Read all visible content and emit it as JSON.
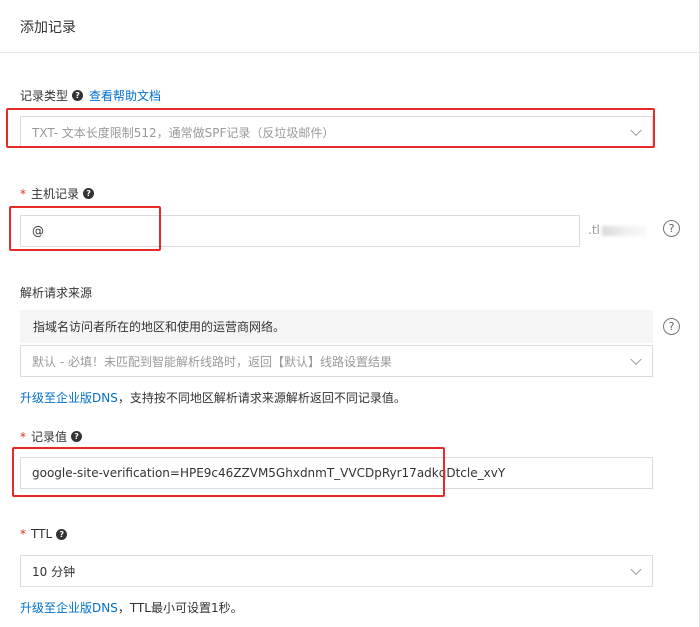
{
  "header": {
    "title": "添加记录"
  },
  "record_type": {
    "label": "记录类型",
    "help_link": "查看帮助文档",
    "value": "TXT- 文本长度限制512，通常做SPF记录（反垃圾邮件）"
  },
  "host": {
    "required_mark": "*",
    "label": "主机记录",
    "value": "@",
    "suffix": ".tl"
  },
  "source": {
    "label": "解析请求来源",
    "info": "指域名访问者所在的地区和使用的运营商网络。",
    "value": "默认 - 必填！未匹配到智能解析线路时，返回【默认】线路设置结果",
    "note_link": "升级至企业版DNS",
    "note_text": "，支持按不同地区解析请求来源解析返回不同记录值。"
  },
  "record_value": {
    "required_mark": "*",
    "label": "记录值",
    "value": "google-site-verification=HPE9c46ZZVM5GhxdnmT_VVCDpRyr17adkqDtcle_xvY"
  },
  "ttl": {
    "required_mark": "*",
    "label": "TTL",
    "value": "10 分钟",
    "note_link": "升级至企业版DNS",
    "note_text": "，TTL最小可设置1秒。"
  },
  "icons": {
    "help": "?",
    "question": "?"
  },
  "colors": {
    "link": "#0070cc",
    "required": "#e0301e",
    "highlight": "#e62a2a"
  }
}
